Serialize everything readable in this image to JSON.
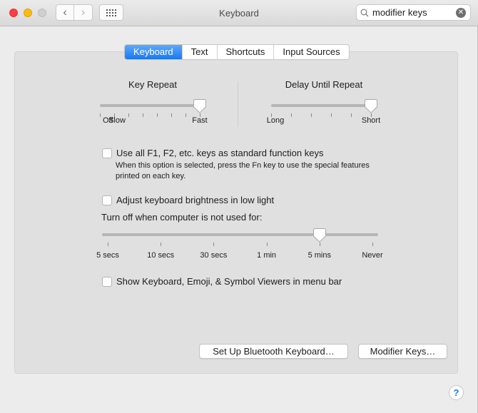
{
  "window": {
    "title": "Keyboard",
    "traffic_lights": {
      "close_color": "#fc3f45",
      "minimize_color": "#fdbb12",
      "zoom_color": "#cfcfcf"
    },
    "nav": {
      "back_icon": "‹",
      "forward_icon": "›"
    },
    "search": {
      "value": "modifier keys",
      "clear_icon": "✕"
    }
  },
  "tabs": [
    {
      "label": "Keyboard",
      "active": true
    },
    {
      "label": "Text",
      "active": false
    },
    {
      "label": "Shortcuts",
      "active": false
    },
    {
      "label": "Input Sources",
      "active": false
    }
  ],
  "key_repeat": {
    "title": "Key Repeat",
    "min_label": "Off",
    "slow_label": "Slow",
    "max_label": "Fast",
    "tick_count": 8,
    "value_fraction": 1.0
  },
  "delay_until_repeat": {
    "title": "Delay Until Repeat",
    "min_label": "Long",
    "max_label": "Short",
    "tick_count": 6,
    "value_fraction": 1.0
  },
  "function_keys": {
    "label": "Use all F1, F2, etc. keys as standard function keys",
    "checked": false,
    "help": "When this option is selected, press the Fn key to use the special features printed on each key."
  },
  "brightness": {
    "label": "Adjust keyboard brightness in low light",
    "checked": false
  },
  "turn_off": {
    "label": "Turn off when computer is not used for:",
    "ticks": [
      "5 secs",
      "10 secs",
      "30 secs",
      "1 min",
      "5 mins",
      "Never"
    ],
    "selected_index": 4
  },
  "viewers": {
    "label": "Show Keyboard, Emoji, & Symbol Viewers in menu bar",
    "checked": false
  },
  "buttons": {
    "bluetooth": "Set Up Bluetooth Keyboard…",
    "modifier": "Modifier Keys…"
  },
  "help_button": "?",
  "accent_color": "#1878f3"
}
